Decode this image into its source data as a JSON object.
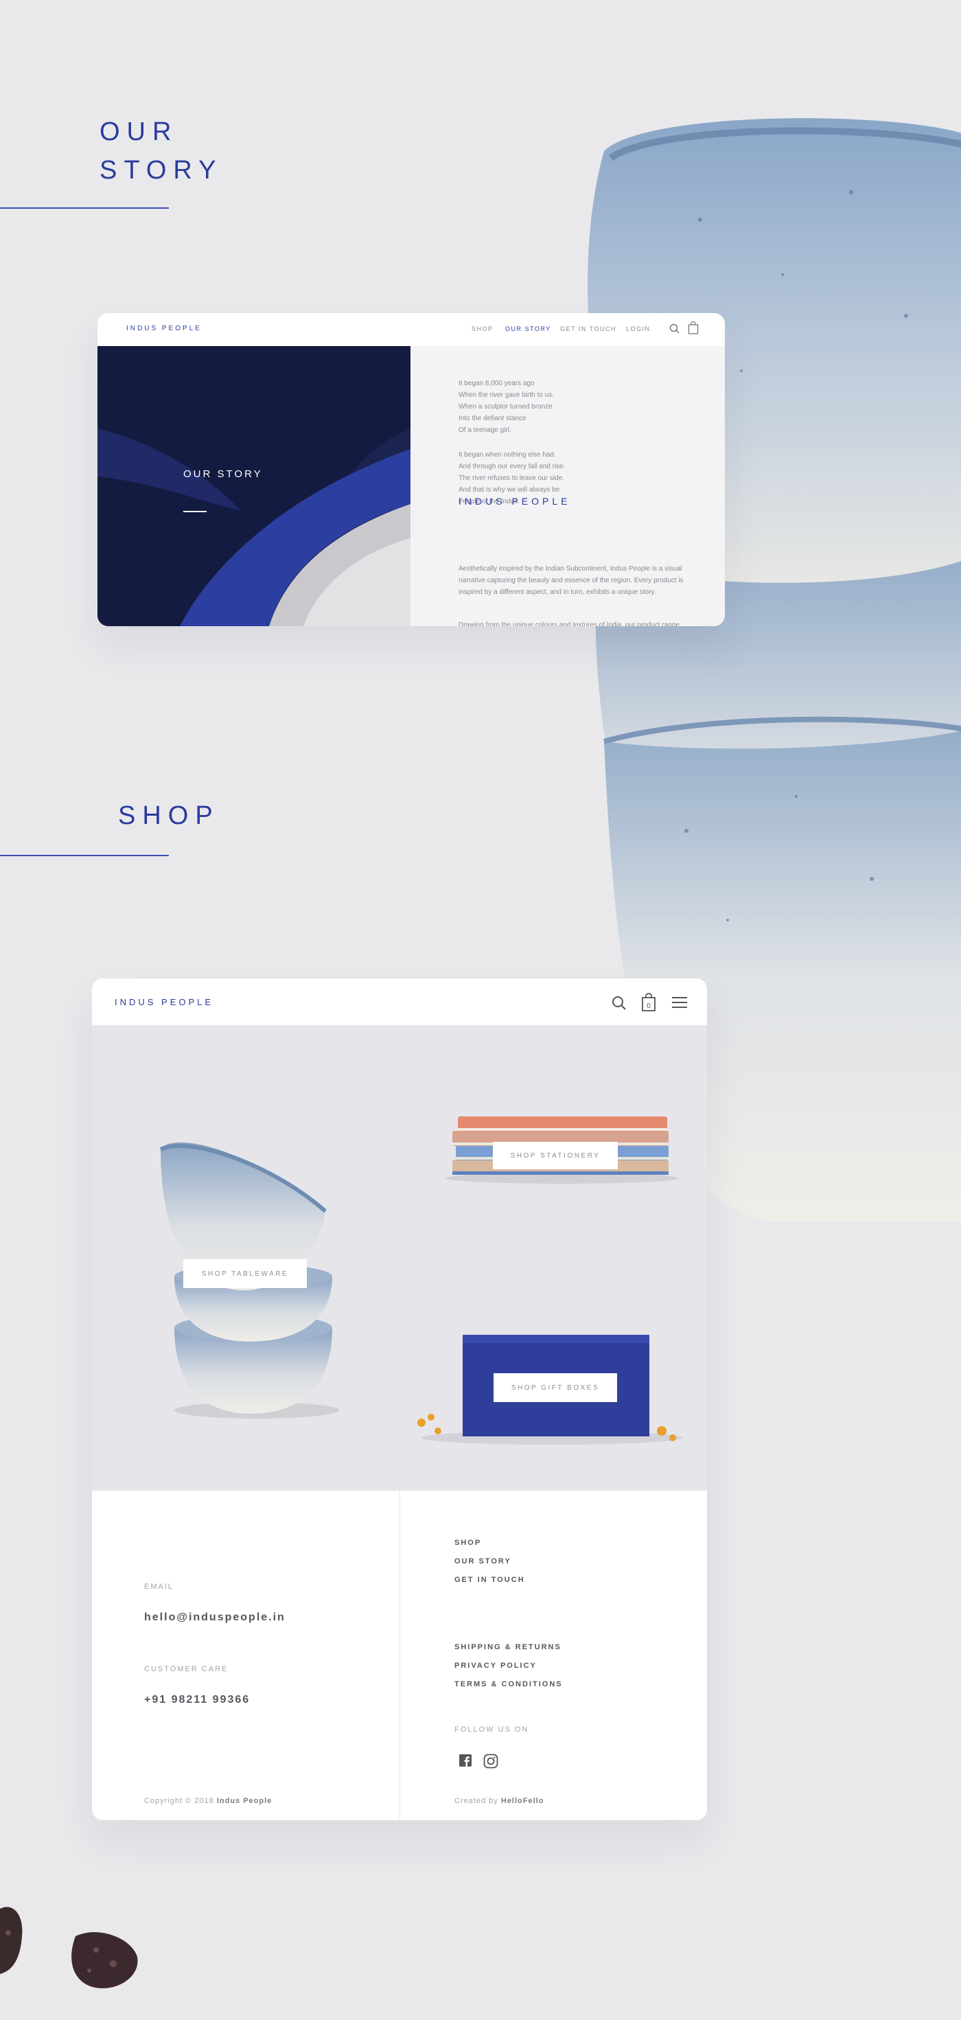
{
  "sections": {
    "story_title_line1": "OUR",
    "story_title_line2": "STORY",
    "shop_title": "SHOP"
  },
  "story_page": {
    "brand": "INDUS PEOPLE",
    "nav": {
      "shop": "SHOP",
      "our_story": "OUR STORY",
      "get_in_touch": "GET IN TOUCH",
      "login": "LOGIN"
    },
    "cart_count": "0",
    "hero_title": "OUR STORY",
    "poem1": "It began 8,000 years ago\nWhen the river gave birth to us.\nWhen a sculptor turned bronze\nInto the defiant stance\nOf a teenage girl.",
    "poem2": "It began when nothing else had.\nAnd through our every fall and rise.\nThe river refuses to leave our side.\nAnd that is why we will always be\nPeople of the Indus.",
    "heading": "INDUS PEOPLE",
    "paragraph1": "Aesthetically inspired by the Indian Subcontinent, Indus People is a visual narrative capturing the beauty and essence of the region. Every product is inspired by a different aspect, and in turn, exhibits a unique story.",
    "paragraph2": "Drawing from the unique colours and textures of India, our product range"
  },
  "shop_page": {
    "brand": "INDUS PEOPLE",
    "cart_count": "0",
    "cta_tableware": "SHOP TABLEWARE",
    "cta_stationery": "SHOP STATIONERY",
    "cta_giftboxes": "SHOP GIFT BOXES",
    "footer": {
      "email_label": "EMAIL",
      "email": "hello@induspeople.in",
      "care_label": "CUSTOMER CARE",
      "phone": "+91 98211 99366",
      "links1": [
        "SHOP",
        "OUR STORY",
        "GET IN TOUCH"
      ],
      "links2": [
        "SHIPPING & RETURNS",
        "PRIVACY POLICY",
        "TERMS & CONDITIONS"
      ],
      "follow": "FOLLOW US ON",
      "copyright": "Copyright © 2018",
      "copyright_brand": "Indus People",
      "created": "Created by",
      "creator": "HelloFello"
    }
  },
  "colors": {
    "accent": "#2a3b9c",
    "background": "#e9e9ec",
    "bowl_blue": "#6e8fb4"
  }
}
